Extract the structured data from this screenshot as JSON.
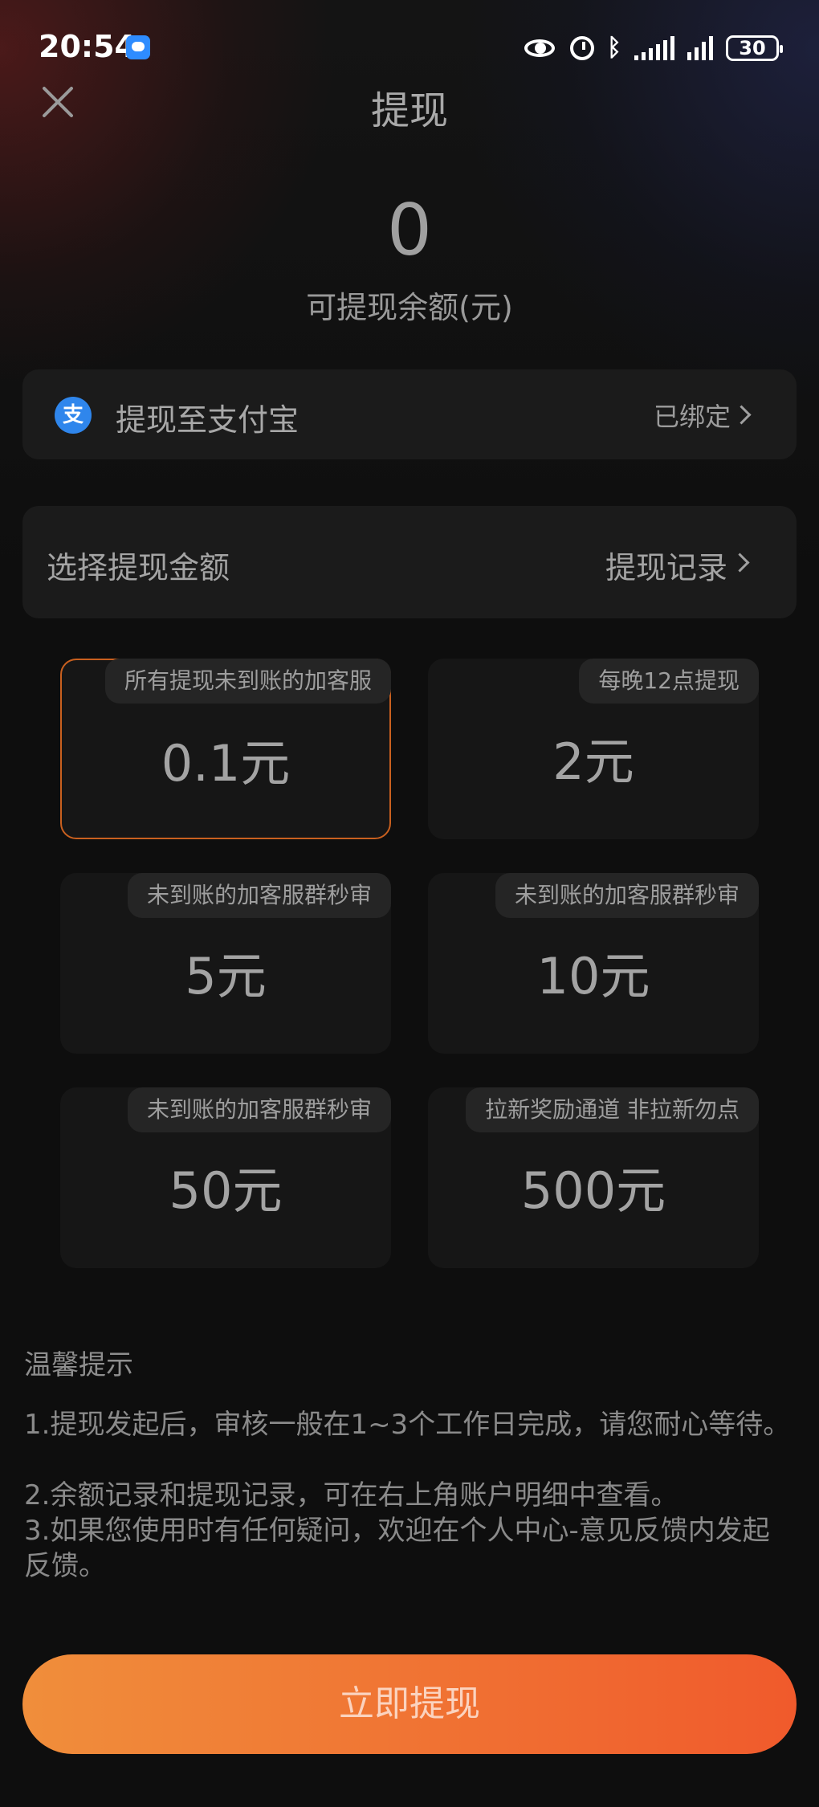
{
  "status_bar": {
    "time": "20:54",
    "battery": "30",
    "bluetooth_glyph": "ᛒ"
  },
  "header": {
    "title": "提现"
  },
  "balance": {
    "value": "0",
    "label": "可提现余额(元)"
  },
  "alipay": {
    "icon_glyph": "支",
    "label": "提现至支付宝",
    "status": "已绑定"
  },
  "amount_section": {
    "label": "选择提现金额",
    "record_link": "提现记录"
  },
  "options": [
    {
      "tag": "所有提现未到账的加客服",
      "value": "0.1元",
      "selected": true
    },
    {
      "tag": "每晚12点提现",
      "value": "2元",
      "selected": false
    },
    {
      "tag": "未到账的加客服群秒审",
      "value": "5元",
      "selected": false
    },
    {
      "tag": "未到账的加客服群秒审",
      "value": "10元",
      "selected": false
    },
    {
      "tag": "未到账的加客服群秒审",
      "value": "50元",
      "selected": false
    },
    {
      "tag": "拉新奖励通道 非拉新勿点",
      "value": "500元",
      "selected": false
    }
  ],
  "tips": {
    "title": "温馨提示",
    "lines": [
      "1.提现发起后，审核一般在1~3个工作日完成，请您耐心等待。",
      "2.余额记录和提现记录，可在右上角账户明细中查看。",
      "3.如果您使用时有任何疑问，欢迎在个人中心-意见反馈内发起反馈。"
    ]
  },
  "submit": {
    "label": "立即提现"
  },
  "colors": {
    "accent_start": "#f08e3b",
    "accent_end": "#f05a2c",
    "selected_border": "#c9601f",
    "alipay_blue": "#2f86ec"
  }
}
